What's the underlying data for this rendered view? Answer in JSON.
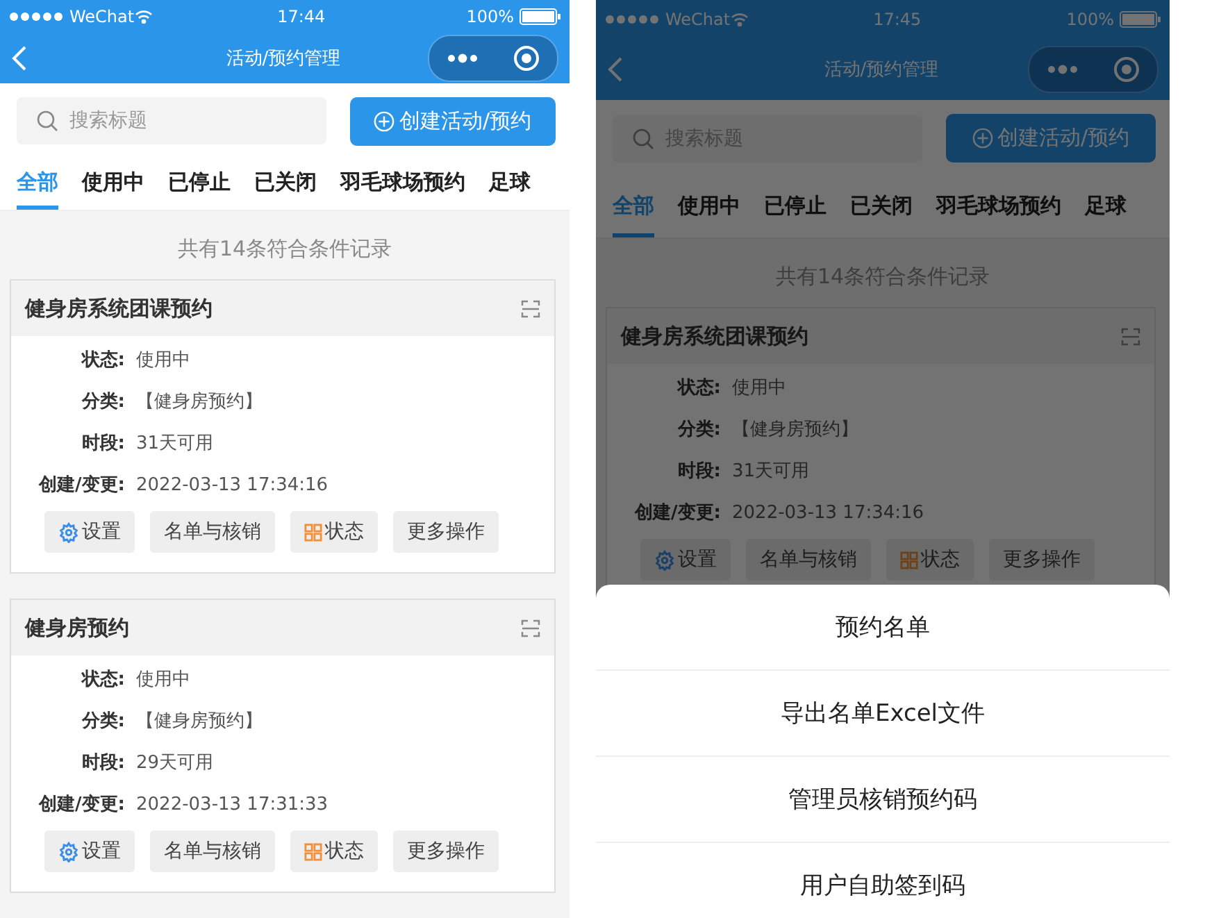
{
  "screens": [
    {
      "status_bar": {
        "carrier": "WeChat",
        "time": "17:44",
        "battery": "100%"
      },
      "nav": {
        "title": "活动/预约管理"
      },
      "search": {
        "placeholder": "搜索标题"
      },
      "create_button": "创建活动/预约",
      "tabs": [
        {
          "label": "全部",
          "selected": true
        },
        {
          "label": "使用中",
          "selected": false
        },
        {
          "label": "已停止",
          "selected": false
        },
        {
          "label": "已关闭",
          "selected": false
        },
        {
          "label": "羽毛球场预约",
          "selected": false
        },
        {
          "label": "足球",
          "selected": false
        }
      ],
      "summary": "共有14条符合条件记录",
      "cards": [
        {
          "title": "健身房系统团课预约",
          "fields": [
            {
              "label": "状态:",
              "value": "使用中"
            },
            {
              "label": "分类:",
              "value": "【健身房预约】"
            },
            {
              "label": "时段:",
              "value": "31天可用"
            },
            {
              "label": "创建/变更:",
              "value": "2022-03-13 17:34:16"
            }
          ],
          "actions": [
            {
              "kind": "settings",
              "label": "设置"
            },
            {
              "kind": "plain",
              "label": "名单与核销"
            },
            {
              "kind": "status",
              "label": "状态"
            },
            {
              "kind": "plain",
              "label": "更多操作"
            }
          ]
        },
        {
          "title": "健身房预约",
          "fields": [
            {
              "label": "状态:",
              "value": "使用中"
            },
            {
              "label": "分类:",
              "value": "【健身房预约】"
            },
            {
              "label": "时段:",
              "value": "29天可用"
            },
            {
              "label": "创建/变更:",
              "value": "2022-03-13 17:31:33"
            }
          ],
          "actions": [
            {
              "kind": "settings",
              "label": "设置"
            },
            {
              "kind": "plain",
              "label": "名单与核销"
            },
            {
              "kind": "status",
              "label": "状态"
            },
            {
              "kind": "plain",
              "label": "更多操作"
            }
          ]
        }
      ]
    },
    {
      "status_bar": {
        "carrier": "WeChat",
        "time": "17:45",
        "battery": "100%"
      },
      "nav": {
        "title": "活动/预约管理"
      },
      "search": {
        "placeholder": "搜索标题"
      },
      "create_button": "创建活动/预约",
      "tabs": [
        {
          "label": "全部",
          "selected": true
        },
        {
          "label": "使用中",
          "selected": false
        },
        {
          "label": "已停止",
          "selected": false
        },
        {
          "label": "已关闭",
          "selected": false
        },
        {
          "label": "羽毛球场预约",
          "selected": false
        },
        {
          "label": "足球",
          "selected": false
        }
      ],
      "summary": "共有14条符合条件记录",
      "cards": [
        {
          "title": "健身房系统团课预约",
          "fields": [
            {
              "label": "状态:",
              "value": "使用中"
            },
            {
              "label": "分类:",
              "value": "【健身房预约】"
            },
            {
              "label": "时段:",
              "value": "31天可用"
            },
            {
              "label": "创建/变更:",
              "value": "2022-03-13 17:34:16"
            }
          ],
          "actions": [
            {
              "kind": "settings",
              "label": "设置"
            },
            {
              "kind": "plain",
              "label": "名单与核销"
            },
            {
              "kind": "status",
              "label": "状态"
            },
            {
              "kind": "plain",
              "label": "更多操作"
            }
          ]
        }
      ],
      "action_sheet": [
        "预约名单",
        "导出名单Excel文件",
        "管理员核销预约码",
        "用户自助签到码"
      ]
    }
  ]
}
